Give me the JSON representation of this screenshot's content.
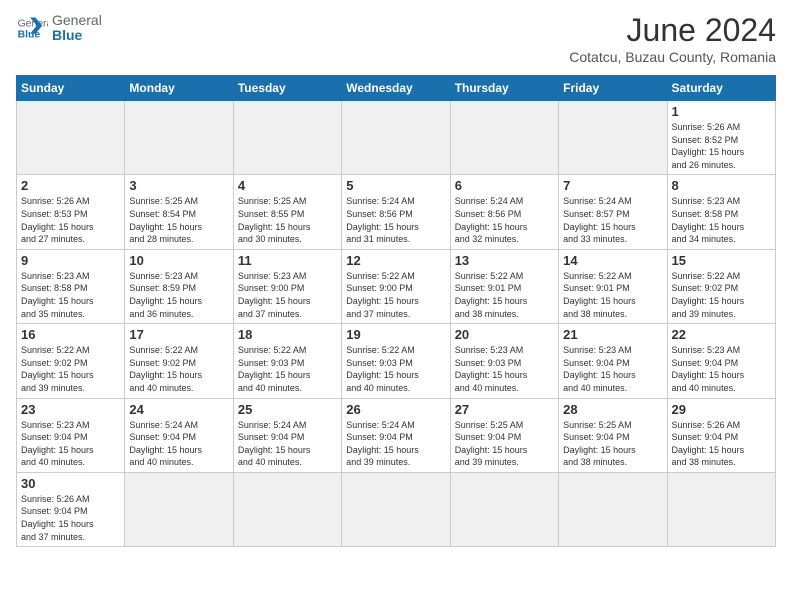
{
  "header": {
    "logo_general": "General",
    "logo_blue": "Blue",
    "month_title": "June 2024",
    "subtitle": "Cotatcu, Buzau County, Romania"
  },
  "weekdays": [
    "Sunday",
    "Monday",
    "Tuesday",
    "Wednesday",
    "Thursday",
    "Friday",
    "Saturday"
  ],
  "weeks": [
    [
      {
        "day": "",
        "info": "",
        "empty": true
      },
      {
        "day": "",
        "info": "",
        "empty": true
      },
      {
        "day": "",
        "info": "",
        "empty": true
      },
      {
        "day": "",
        "info": "",
        "empty": true
      },
      {
        "day": "",
        "info": "",
        "empty": true
      },
      {
        "day": "",
        "info": "",
        "empty": true
      },
      {
        "day": "1",
        "info": "Sunrise: 5:26 AM\nSunset: 8:52 PM\nDaylight: 15 hours\nand 26 minutes.",
        "empty": false
      }
    ],
    [
      {
        "day": "2",
        "info": "Sunrise: 5:26 AM\nSunset: 8:53 PM\nDaylight: 15 hours\nand 27 minutes.",
        "empty": false
      },
      {
        "day": "3",
        "info": "Sunrise: 5:25 AM\nSunset: 8:54 PM\nDaylight: 15 hours\nand 28 minutes.",
        "empty": false
      },
      {
        "day": "4",
        "info": "Sunrise: 5:25 AM\nSunset: 8:55 PM\nDaylight: 15 hours\nand 30 minutes.",
        "empty": false
      },
      {
        "day": "5",
        "info": "Sunrise: 5:24 AM\nSunset: 8:56 PM\nDaylight: 15 hours\nand 31 minutes.",
        "empty": false
      },
      {
        "day": "6",
        "info": "Sunrise: 5:24 AM\nSunset: 8:56 PM\nDaylight: 15 hours\nand 32 minutes.",
        "empty": false
      },
      {
        "day": "7",
        "info": "Sunrise: 5:24 AM\nSunset: 8:57 PM\nDaylight: 15 hours\nand 33 minutes.",
        "empty": false
      },
      {
        "day": "8",
        "info": "Sunrise: 5:23 AM\nSunset: 8:58 PM\nDaylight: 15 hours\nand 34 minutes.",
        "empty": false
      }
    ],
    [
      {
        "day": "9",
        "info": "Sunrise: 5:23 AM\nSunset: 8:58 PM\nDaylight: 15 hours\nand 35 minutes.",
        "empty": false
      },
      {
        "day": "10",
        "info": "Sunrise: 5:23 AM\nSunset: 8:59 PM\nDaylight: 15 hours\nand 36 minutes.",
        "empty": false
      },
      {
        "day": "11",
        "info": "Sunrise: 5:23 AM\nSunset: 9:00 PM\nDaylight: 15 hours\nand 37 minutes.",
        "empty": false
      },
      {
        "day": "12",
        "info": "Sunrise: 5:22 AM\nSunset: 9:00 PM\nDaylight: 15 hours\nand 37 minutes.",
        "empty": false
      },
      {
        "day": "13",
        "info": "Sunrise: 5:22 AM\nSunset: 9:01 PM\nDaylight: 15 hours\nand 38 minutes.",
        "empty": false
      },
      {
        "day": "14",
        "info": "Sunrise: 5:22 AM\nSunset: 9:01 PM\nDaylight: 15 hours\nand 38 minutes.",
        "empty": false
      },
      {
        "day": "15",
        "info": "Sunrise: 5:22 AM\nSunset: 9:02 PM\nDaylight: 15 hours\nand 39 minutes.",
        "empty": false
      }
    ],
    [
      {
        "day": "16",
        "info": "Sunrise: 5:22 AM\nSunset: 9:02 PM\nDaylight: 15 hours\nand 39 minutes.",
        "empty": false
      },
      {
        "day": "17",
        "info": "Sunrise: 5:22 AM\nSunset: 9:02 PM\nDaylight: 15 hours\nand 40 minutes.",
        "empty": false
      },
      {
        "day": "18",
        "info": "Sunrise: 5:22 AM\nSunset: 9:03 PM\nDaylight: 15 hours\nand 40 minutes.",
        "empty": false
      },
      {
        "day": "19",
        "info": "Sunrise: 5:22 AM\nSunset: 9:03 PM\nDaylight: 15 hours\nand 40 minutes.",
        "empty": false
      },
      {
        "day": "20",
        "info": "Sunrise: 5:23 AM\nSunset: 9:03 PM\nDaylight: 15 hours\nand 40 minutes.",
        "empty": false
      },
      {
        "day": "21",
        "info": "Sunrise: 5:23 AM\nSunset: 9:04 PM\nDaylight: 15 hours\nand 40 minutes.",
        "empty": false
      },
      {
        "day": "22",
        "info": "Sunrise: 5:23 AM\nSunset: 9:04 PM\nDaylight: 15 hours\nand 40 minutes.",
        "empty": false
      }
    ],
    [
      {
        "day": "23",
        "info": "Sunrise: 5:23 AM\nSunset: 9:04 PM\nDaylight: 15 hours\nand 40 minutes.",
        "empty": false
      },
      {
        "day": "24",
        "info": "Sunrise: 5:24 AM\nSunset: 9:04 PM\nDaylight: 15 hours\nand 40 minutes.",
        "empty": false
      },
      {
        "day": "25",
        "info": "Sunrise: 5:24 AM\nSunset: 9:04 PM\nDaylight: 15 hours\nand 40 minutes.",
        "empty": false
      },
      {
        "day": "26",
        "info": "Sunrise: 5:24 AM\nSunset: 9:04 PM\nDaylight: 15 hours\nand 39 minutes.",
        "empty": false
      },
      {
        "day": "27",
        "info": "Sunrise: 5:25 AM\nSunset: 9:04 PM\nDaylight: 15 hours\nand 39 minutes.",
        "empty": false
      },
      {
        "day": "28",
        "info": "Sunrise: 5:25 AM\nSunset: 9:04 PM\nDaylight: 15 hours\nand 38 minutes.",
        "empty": false
      },
      {
        "day": "29",
        "info": "Sunrise: 5:26 AM\nSunset: 9:04 PM\nDaylight: 15 hours\nand 38 minutes.",
        "empty": false
      }
    ],
    [
      {
        "day": "30",
        "info": "Sunrise: 5:26 AM\nSunset: 9:04 PM\nDaylight: 15 hours\nand 37 minutes.",
        "empty": false
      },
      {
        "day": "",
        "info": "",
        "empty": true
      },
      {
        "day": "",
        "info": "",
        "empty": true
      },
      {
        "day": "",
        "info": "",
        "empty": true
      },
      {
        "day": "",
        "info": "",
        "empty": true
      },
      {
        "day": "",
        "info": "",
        "empty": true
      },
      {
        "day": "",
        "info": "",
        "empty": true
      }
    ]
  ]
}
